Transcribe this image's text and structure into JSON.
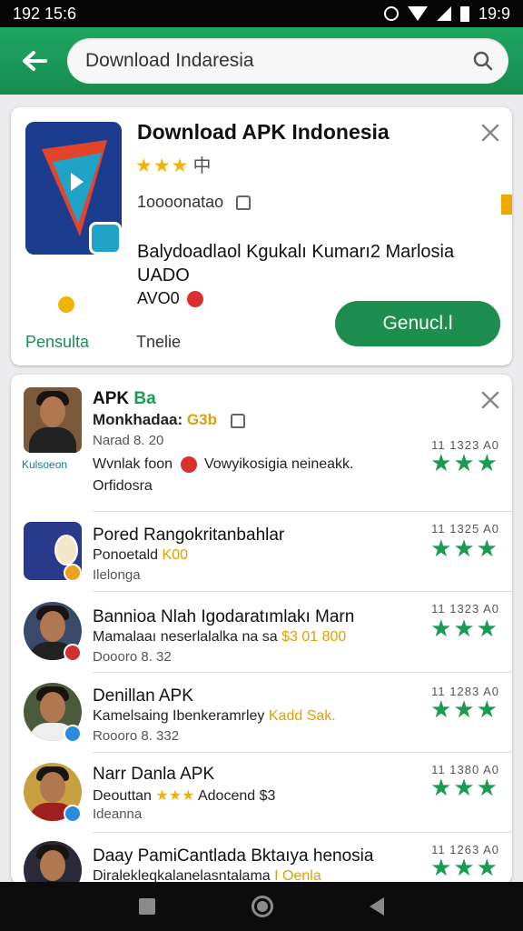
{
  "status_bar": {
    "time": "192 15:6",
    "right_time": "19:9"
  },
  "search": {
    "value": "Download Indaresia",
    "placeholder": ""
  },
  "featured": {
    "title": "Download APK Indonesia",
    "stars": "★★★",
    "cjk_glyph": "中",
    "downloads": "1oooonatao",
    "description_line1": "Balydoadlaol Kgukalı Kumarı2 Marlosia",
    "description_line2": "UADO",
    "version": "AVO0",
    "footer_left": "Pensulta",
    "footer_mid": "Tnelie",
    "install_label": "Genucl.l"
  },
  "list": [
    {
      "title": "APK",
      "title_badge": "Ba",
      "subtitle": "Monkhadaa:",
      "subtitle_extra": "G3b",
      "meta": "Narad 8. 20",
      "desc_line1": "Wvnlak foon",
      "desc_line2": "Vowyikosigia neineakk.",
      "desc_line3": "Orfidosra",
      "avatar_caption": "Kulsoeon",
      "date": "11 1323   A0",
      "rating": "★★★"
    },
    {
      "title": "Pored Rangokritanbahlar",
      "subtitle": "Ponoetald",
      "subtitle_extra": "K00",
      "meta": "Ilelonga",
      "date": "11 1325   A0",
      "rating": "★★★"
    },
    {
      "title": "Bannioa Nlah Igodaratımlakı Marn",
      "subtitle": "Mamalaaı neserlalalka na sa",
      "subtitle_extra": "$3 01 800",
      "meta": "Doooro 8. 32",
      "date": "11 1323   A0",
      "rating": "★★★"
    },
    {
      "title": "Denillan APK",
      "subtitle": "Kamelsaing Ibenkeramrley",
      "subtitle_extra": "Kadd Sak.",
      "meta": "Roooro 8. 332",
      "date": "11 1283   A0",
      "rating": "★★★"
    },
    {
      "title": "Narr Danla APK",
      "subtitle": "Deouttan",
      "subtitle_stars": "★★★",
      "subtitle_extra": "Adocend $3",
      "meta": "Ideanna",
      "date": "11 1380   A0",
      "rating": "★★★"
    },
    {
      "title": "Daay PamiCantlada Bktaıya henosia",
      "subtitle": "Diralekleqkalanelasntalama",
      "subtitle_extra": "I Oenla",
      "date": "11 1263   A0",
      "rating": "★★★"
    }
  ],
  "colors": {
    "header_green": "#1fa660",
    "install_green": "#1e8e4f",
    "rating_green": "#1a9a52",
    "star_gold": "#f0b400"
  }
}
